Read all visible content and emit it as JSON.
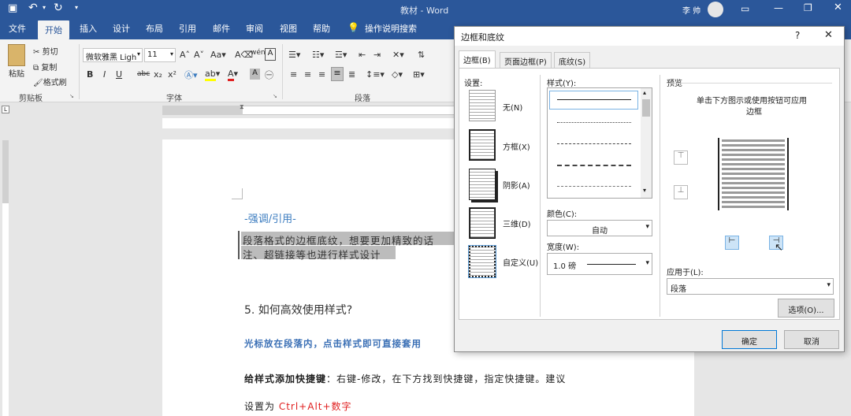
{
  "window": {
    "title": "教材 - Word",
    "user": "李 帅"
  },
  "ribbon_tabs": [
    "文件",
    "开始",
    "插入",
    "设计",
    "布局",
    "引用",
    "邮件",
    "审阅",
    "视图",
    "帮助"
  ],
  "tell_me": "操作说明搜索",
  "clipboard": {
    "paste": "粘贴",
    "cut": "剪切",
    "copy": "复制",
    "format_painter": "格式刷",
    "group": "剪贴板"
  },
  "font": {
    "name": "微软雅黑 Ligh",
    "size": "11",
    "group": "字体",
    "bold": "B",
    "italic": "I",
    "underline": "U",
    "strike": "abc",
    "sub": "x₂",
    "sup": "x²"
  },
  "paragraph": {
    "group": "段落"
  },
  "doc": {
    "heading": "-强调/引用-",
    "line1": "段落格式的边框底纹，想要更加精致的话",
    "line2": "注、超链接等也进行样式设计",
    "section": "5. 如何高效使用样式?",
    "blue": "光标放在段落内，点击样式即可直接套用",
    "bold_lead": "给样式添加快捷键",
    "rest": "：右键-修改，在下方找到快捷键，指定快捷键。建议",
    "line6_pre": "设置为 ",
    "line6_red": "Ctrl+Alt+数字"
  },
  "dialog": {
    "title": "边框和底纹",
    "help": "?",
    "tabs": [
      "边框(B)",
      "页面边框(P)",
      "底纹(S)"
    ],
    "setting_label": "设置:",
    "settings": [
      "无(N)",
      "方框(X)",
      "阴影(A)",
      "三维(D)",
      "自定义(U)"
    ],
    "style_label": "样式(Y):",
    "color_label": "颜色(C):",
    "color_value": "自动",
    "width_label": "宽度(W):",
    "width_value": "1.0 磅",
    "preview_label": "预览",
    "preview_hint_1": "单击下方图示或使用按钮可应用",
    "preview_hint_2": "边框",
    "apply_label": "应用于(L):",
    "apply_value": "段落",
    "options": "选项(O)...",
    "ok": "确定",
    "cancel": "取消"
  },
  "colors": {
    "accent": "#2b579a",
    "heading": "#3a7bbf",
    "red": "#e02020"
  }
}
